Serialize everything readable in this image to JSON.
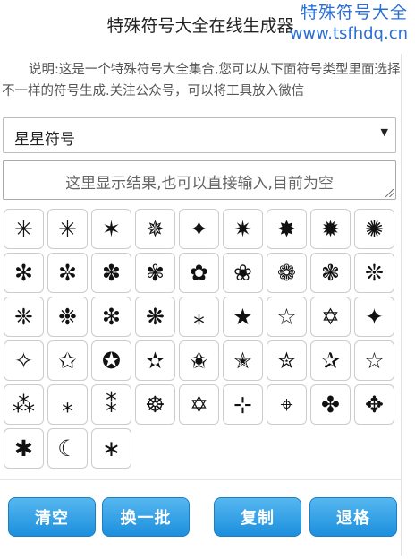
{
  "page_title": "特殊符号大全在线生成器",
  "watermark": {
    "line1": "特殊符号大全",
    "line2": "www.tsfhdq.cn"
  },
  "description": "说明:这是一个特殊符号大全集合,您可以从下面符号类型里面选择不一样的符号生成.关注公众号，可以将工具放入微信",
  "category_select": {
    "selected": "星星符号",
    "arrow": "▼"
  },
  "result_box": {
    "placeholder": "这里显示结果,也可以直接输入,目前为空"
  },
  "symbols": [
    "✳",
    "✳",
    "✶",
    "✵",
    "✦",
    "✷",
    "✸",
    "✹",
    "✺",
    "✻",
    "✼",
    "✽",
    "✾",
    "✿",
    "❀",
    "❁",
    "❃",
    "❊",
    "❈",
    "❉",
    "❇",
    "❋",
    "⁎",
    "★",
    "☆",
    "✡",
    "✦",
    "✧",
    "✩",
    "✪",
    "✫",
    "✬",
    "✭",
    "✮",
    "✰",
    "☆",
    "⁂",
    "⁎",
    "⁑",
    "☸",
    "✡",
    "⊹",
    "⌖",
    "✤",
    "✥",
    "✱",
    "☾",
    "∗"
  ],
  "buttons": {
    "clear": "清空",
    "refresh": "换一批",
    "copy": "复制",
    "backspace": "退格"
  },
  "colors": {
    "watermark": "#2a6fd6",
    "button_top": "#56b7f0",
    "button_bottom": "#1c8fdd"
  }
}
